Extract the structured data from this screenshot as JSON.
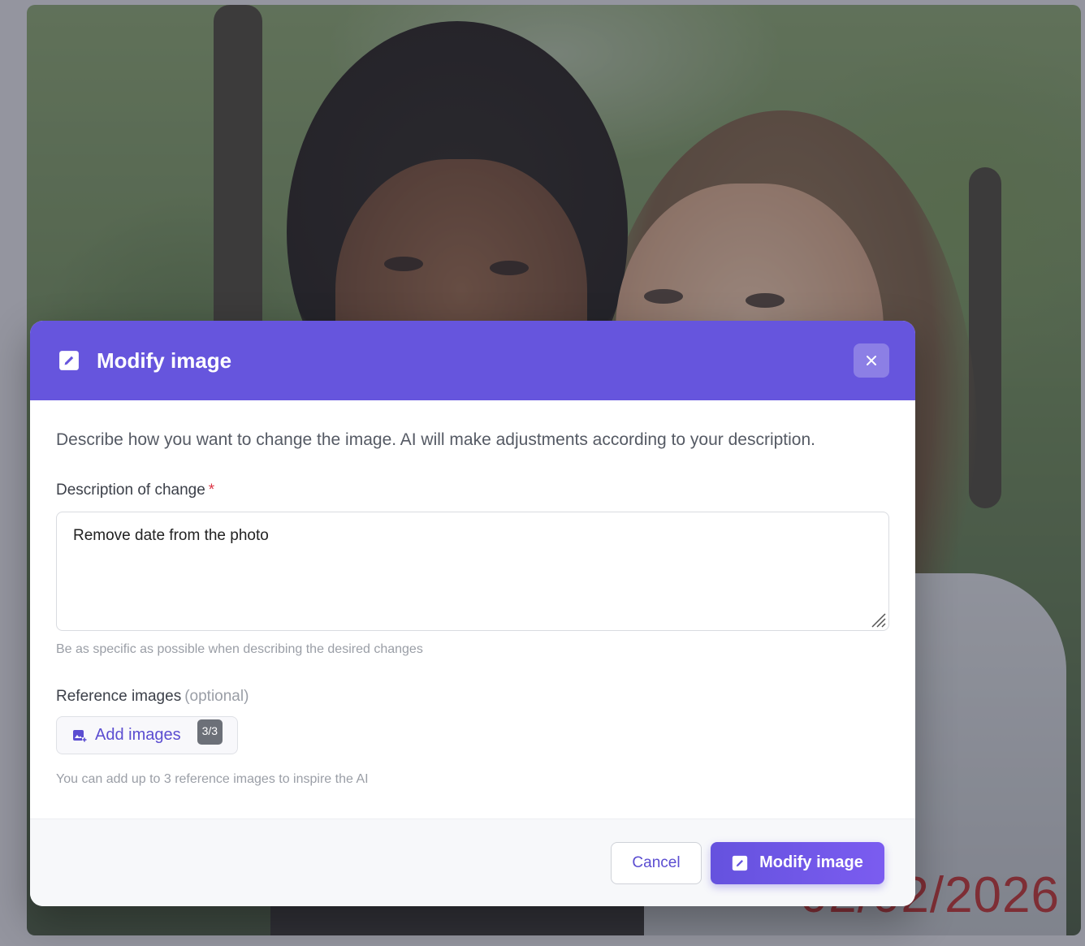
{
  "background": {
    "photo_date_stamp": "02/02/2026",
    "photo_date_color": "#b52121"
  },
  "modal": {
    "title": "Modify image",
    "header_icon": "edit-square-icon",
    "close_icon": "close-icon",
    "accent_color": "#6655dd",
    "intro_text": "Describe how you want to change the image. AI will make adjustments according to your description.",
    "description_field": {
      "label": "Description of change",
      "required_marker": "*",
      "value": "Remove date from the photo",
      "hint": "Be as specific as possible when describing the desired changes"
    },
    "reference_images": {
      "label": "Reference images",
      "optional_text": "(optional)",
      "add_button_label": "Add images",
      "add_button_icon": "add-photo-icon",
      "count_badge": "3/3",
      "hint": "You can add up to 3 reference images to inspire the AI"
    },
    "footer": {
      "cancel_label": "Cancel",
      "submit_label": "Modify image",
      "submit_icon": "edit-square-icon"
    }
  }
}
